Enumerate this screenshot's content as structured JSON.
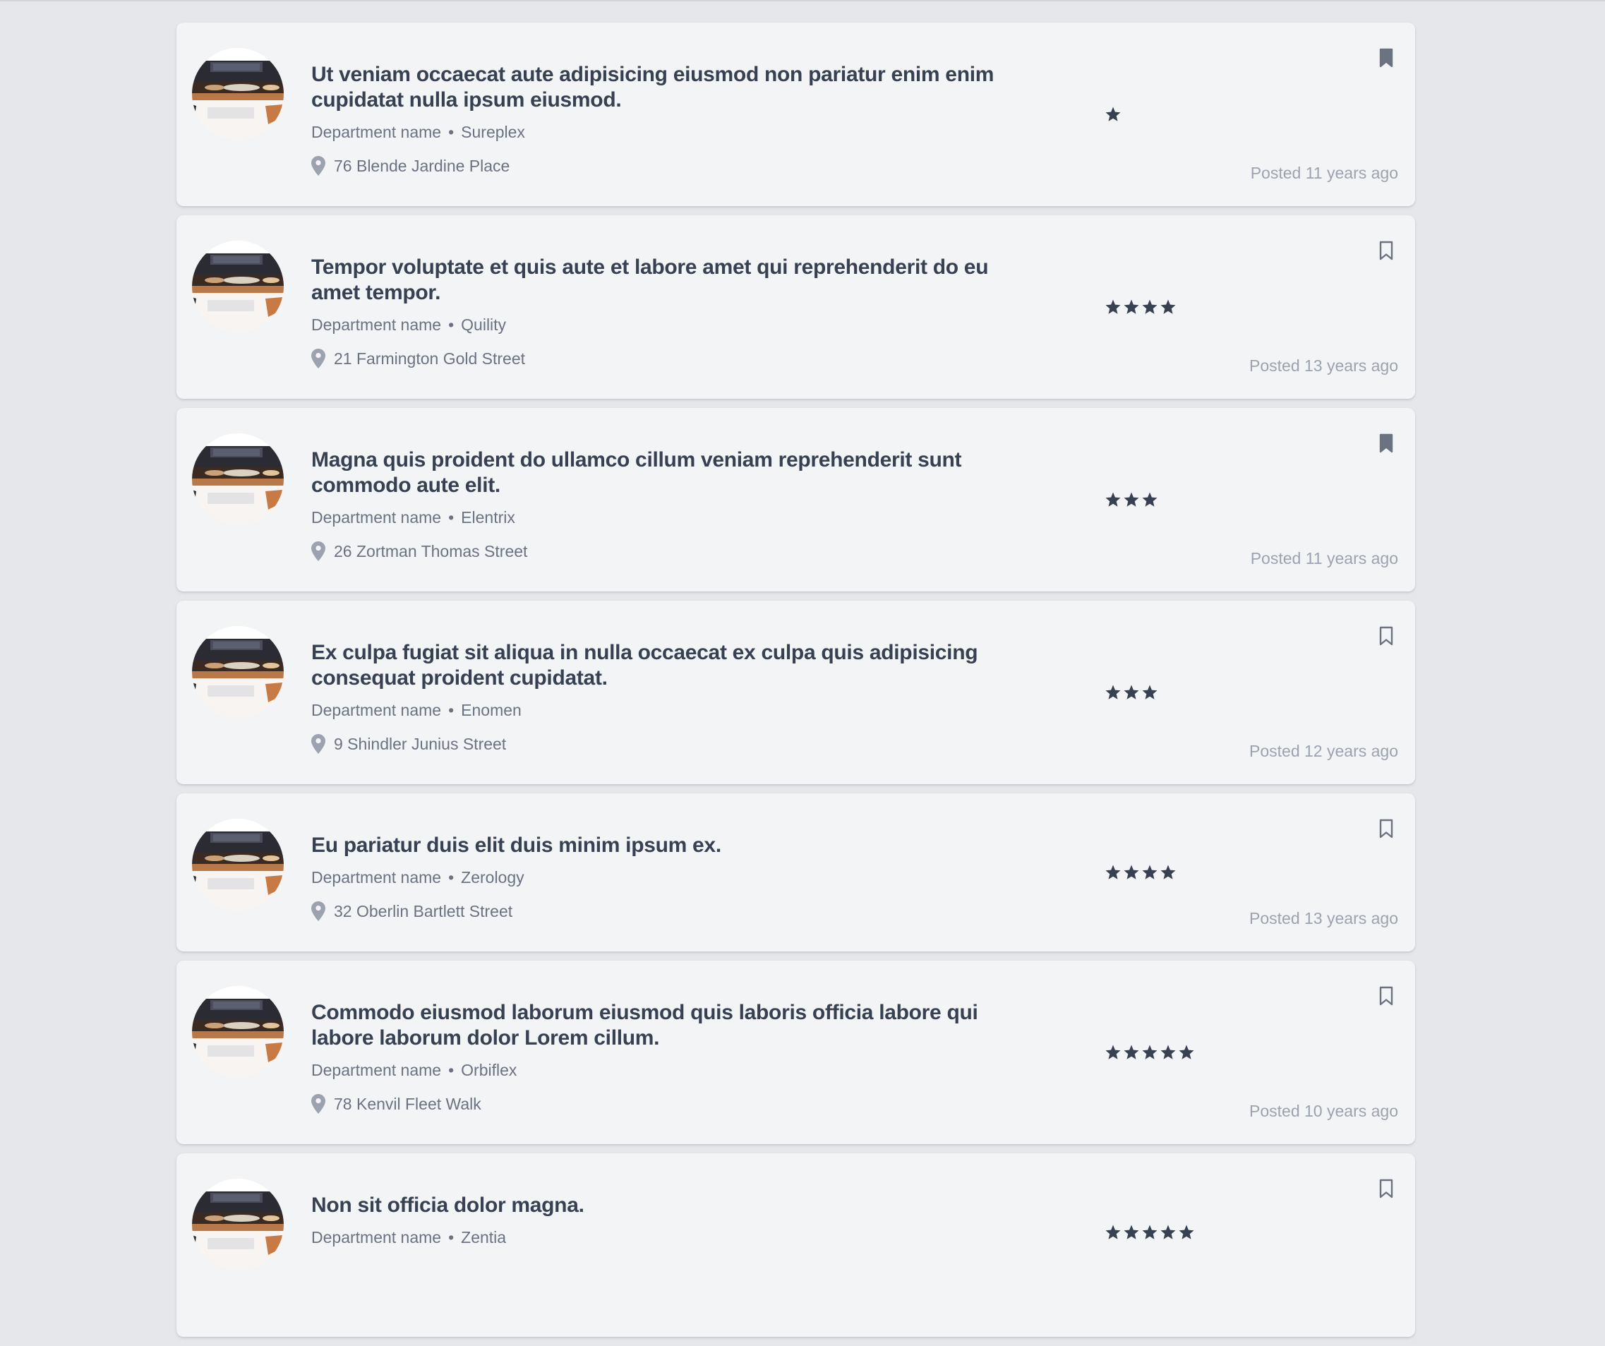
{
  "jobs": [
    {
      "title": "Ut veniam occaecat aute adipisicing eiusmod non pariatur enim enim cupidatat nulla ipsum eiusmod.",
      "department": "Department name",
      "company": "Sureplex",
      "address": "76 Blende Jardine Place",
      "rating": 1,
      "bookmarked": true,
      "posted": "Posted 11 years ago"
    },
    {
      "title": "Tempor voluptate et quis aute et labore amet qui reprehenderit do eu amet tempor.",
      "department": "Department name",
      "company": "Quility",
      "address": "21 Farmington Gold Street",
      "rating": 4,
      "bookmarked": false,
      "posted": "Posted 13 years ago"
    },
    {
      "title": "Magna quis proident do ullamco cillum veniam reprehenderit sunt commodo aute elit.",
      "department": "Department name",
      "company": "Elentrix",
      "address": "26 Zortman Thomas Street",
      "rating": 3,
      "bookmarked": true,
      "posted": "Posted 11 years ago"
    },
    {
      "title": "Ex culpa fugiat sit aliqua in nulla occaecat ex culpa quis adipisicing consequat proident cupidatat.",
      "department": "Department name",
      "company": "Enomen",
      "address": "9 Shindler Junius Street",
      "rating": 3,
      "bookmarked": false,
      "posted": "Posted 12 years ago"
    },
    {
      "title": "Eu pariatur duis elit duis minim ipsum ex.",
      "department": "Department name",
      "company": "Zerology",
      "address": "32 Oberlin Bartlett Street",
      "rating": 4,
      "bookmarked": false,
      "posted": "Posted 13 years ago"
    },
    {
      "title": "Commodo eiusmod laborum eiusmod quis laboris officia labore qui labore laborum dolor Lorem cillum.",
      "department": "Department name",
      "company": "Orbiflex",
      "address": "78 Kenvil Fleet Walk",
      "rating": 5,
      "bookmarked": false,
      "posted": "Posted 10 years ago"
    },
    {
      "title": "Non sit officia dolor magna.",
      "department": "Department name",
      "company": "Zentia",
      "address": "",
      "rating": 5,
      "bookmarked": false,
      "posted": ""
    }
  ],
  "icons": {
    "star": "star-icon",
    "bookmark": "bookmark-icon",
    "location": "map-pin-icon"
  },
  "colors": {
    "page_bg": "#e5e7eb",
    "card_bg": "#f3f4f6",
    "title": "#374151",
    "meta": "#6b7280",
    "posted": "#9ca3af",
    "star": "#374151",
    "bookmark": "#6b7280"
  }
}
